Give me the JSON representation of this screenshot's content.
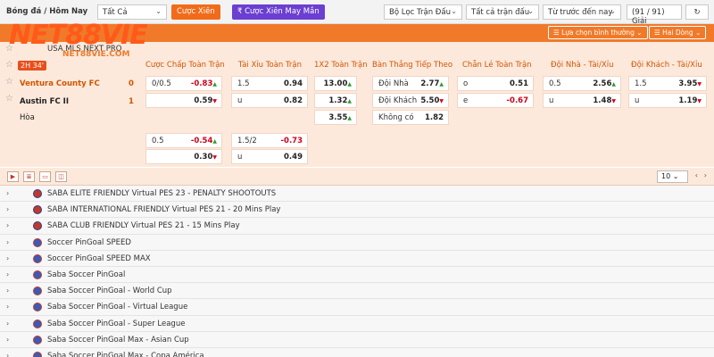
{
  "topbar": {
    "crumb": "Bóng đá / Hôm Nay",
    "filter_all": "Tất Cả",
    "btn_parlay": "Cược Xiên",
    "btn_lucky": "₹ Cược Xiên May Mắn",
    "filter_league": "Bộ Lọc Trận Đấu",
    "filter_matches": "Tất cả trận đấu",
    "sort": "Từ trước đến nay",
    "count": "(91 / 91) Giải"
  },
  "orange_bar": {
    "btn_normal": "Lựa chọn bình thường",
    "btn_two": "Hai Dòng"
  },
  "logo": {
    "text": "NET88VIE",
    "sub": "NET88VIE.COM"
  },
  "league": {
    "name": "USA MLS NEXT PRO"
  },
  "match": {
    "time": "2H 34'",
    "home": "Ventura County FC",
    "away": "Austin FC II",
    "draw": "Hòa",
    "home_score": "0",
    "away_score": "1",
    "columns": [
      "Cược Chấp Toàn Trận",
      "Tài Xỉu Toàn Trận",
      "1X2 Toàn Trận",
      "Bàn Thắng Tiếp Theo",
      "Chẵn Lẻ Toàn Trận",
      "Đội Nhà - Tài/Xỉu",
      "Đội Khách - Tài/Xỉu"
    ],
    "hdp": {
      "line1": "0/0.5",
      "h1": "-0.83",
      "a1": "0.59",
      "line2": "0.5",
      "h2": "-0.54",
      "a2": "0.30"
    },
    "ou": {
      "line1": "1.5",
      "o1": "0.94",
      "ulabel": "u",
      "u1": "0.82",
      "line2": "1.5/2",
      "o2": "-0.73",
      "u2": "0.49"
    },
    "x12": {
      "home": "13.00",
      "away": "1.32",
      "draw": "3.55"
    },
    "next_goal": {
      "home_label": "Đội Nhà",
      "home": "2.77",
      "away_label": "Đội Khách",
      "away": "5.50",
      "none_label": "Không có",
      "none": "1.82"
    },
    "oe": {
      "o_label": "o",
      "o": "0.51",
      "e_label": "e",
      "e": "-0.67"
    },
    "home_ou": {
      "line": "0.5",
      "o": "2.56",
      "u_label": "u",
      "u": "1.48"
    },
    "away_ou": {
      "line": "1.5",
      "o": "3.95",
      "u_label": "u",
      "u": "1.19"
    }
  },
  "pager": {
    "size": "10"
  },
  "leagues": [
    "SABA ELITE FRIENDLY Virtual PES 23 - PENALTY SHOOTOUTS",
    "SABA INTERNATIONAL FRIENDLY Virtual PES 21 - 20 Mins Play",
    "SABA CLUB FRIENDLY Virtual PES 21 - 15 Mins Play",
    "Soccer PinGoal SPEED",
    "Soccer PinGoal SPEED MAX",
    "Saba Soccer PinGoal",
    "Saba Soccer PinGoal - World Cup",
    "Saba Soccer PinGoal - Virtual League",
    "Saba Soccer PinGoal - Super League",
    "Saba Soccer PinGoal Max - Asian Cup",
    "Saba Soccer PinGoal Max - Copa América"
  ]
}
